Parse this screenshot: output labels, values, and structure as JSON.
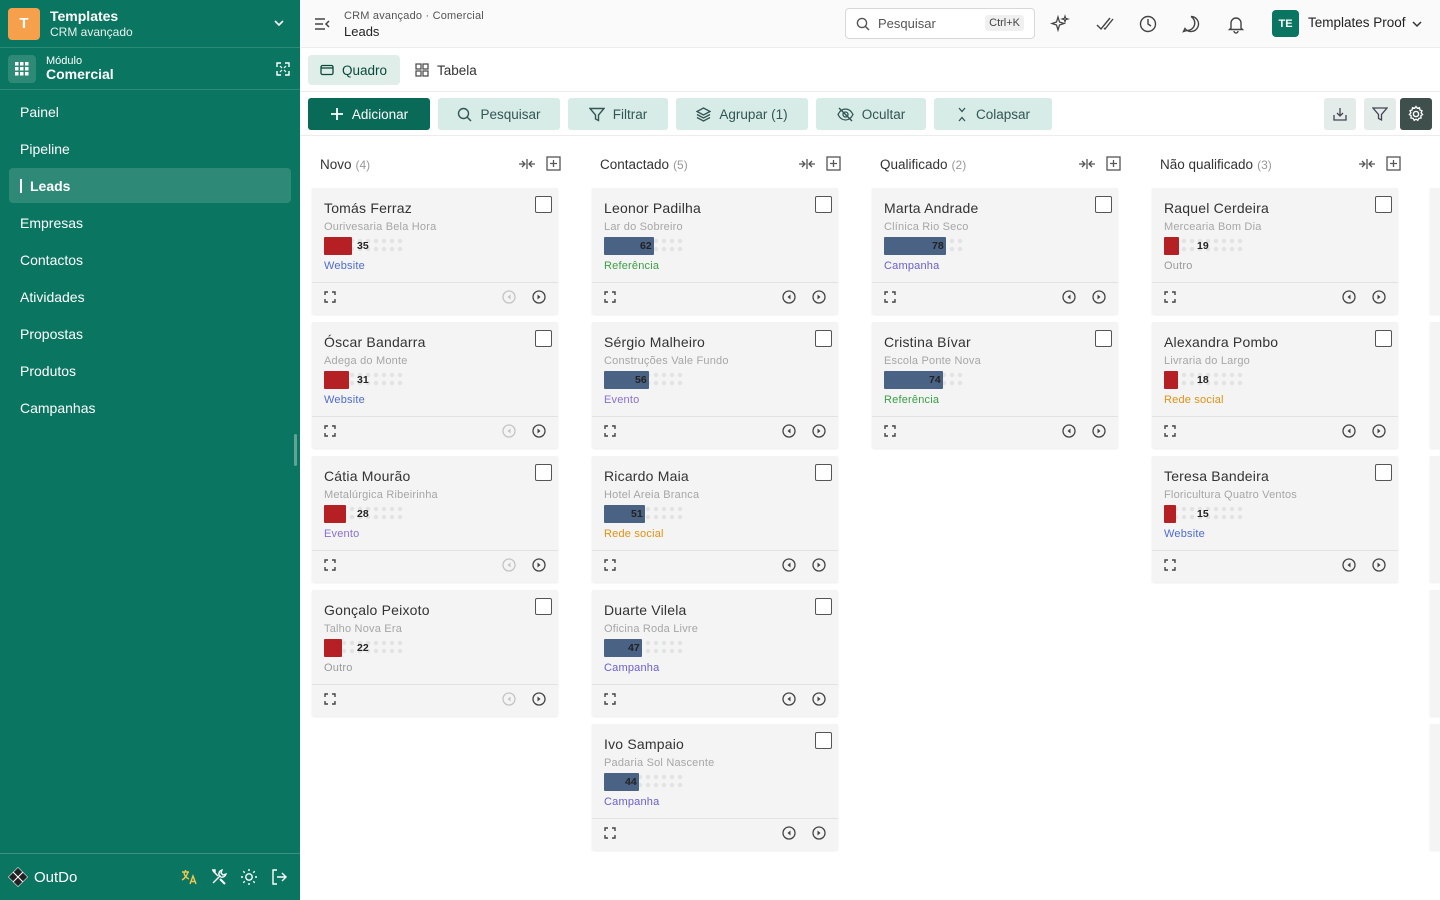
{
  "sidebar": {
    "workspace_initial": "T",
    "workspace_title": "Templates",
    "workspace_subtitle": "CRM avançado",
    "module_label": "Módulo",
    "module_name": "Comercial",
    "items": [
      {
        "label": "Painel"
      },
      {
        "label": "Pipeline"
      },
      {
        "label": "Leads",
        "active": true
      },
      {
        "label": "Empresas"
      },
      {
        "label": "Contactos"
      },
      {
        "label": "Atividades"
      },
      {
        "label": "Propostas"
      },
      {
        "label": "Produtos"
      },
      {
        "label": "Campanhas"
      }
    ],
    "brand": "OutDo"
  },
  "topbar": {
    "breadcrumb": "CRM avançado · Comercial",
    "title": "Leads",
    "search_placeholder": "Pesquisar",
    "search_shortcut": "Ctrl+K",
    "user_initials": "TE",
    "user_name": "Templates Proof"
  },
  "tabs": [
    {
      "label": "Quadro",
      "active": true
    },
    {
      "label": "Tabela"
    }
  ],
  "toolbar": {
    "add": "Adicionar",
    "search": "Pesquisar",
    "filter": "Filtrar",
    "group": "Agrupar (1)",
    "hide": "Ocultar",
    "collapse": "Colapsar"
  },
  "colors": {
    "sidebar_bg": "#0a7560",
    "accent": "#0a6a58",
    "score_low": "#b52025",
    "score_high": "#4a6283",
    "source_website": "#4f6bd4",
    "source_referencia": "#3aa046",
    "source_campanha": "#6a5fd0",
    "source_evento": "#8a6fd4",
    "source_rede_social": "#e29212",
    "source_outro": "#9a9a9a"
  },
  "board": {
    "columns": [
      {
        "name": "Novo",
        "count": "(4)",
        "cards": [
          {
            "name": "Tomás Ferraz",
            "company": "Ourivesaria Bela Hora",
            "score": 35,
            "source": "Website",
            "source_color": "#4f6bd4"
          },
          {
            "name": "Óscar Bandarra",
            "company": "Adega do Monte",
            "score": 31,
            "source": "Website",
            "source_color": "#4f6bd4"
          },
          {
            "name": "Cátia Mourão",
            "company": "Metalúrgica Ribeirinha",
            "score": 28,
            "source": "Evento",
            "source_color": "#8a6fd4"
          },
          {
            "name": "Gonçalo Peixoto",
            "company": "Talho Nova Era",
            "score": 22,
            "source": "Outro",
            "source_color": "#9a9a9a"
          }
        ]
      },
      {
        "name": "Contactado",
        "count": "(5)",
        "cards": [
          {
            "name": "Leonor Padilha",
            "company": "Lar do Sobreiro",
            "score": 62,
            "source": "Referência",
            "source_color": "#3aa046"
          },
          {
            "name": "Sérgio Malheiro",
            "company": "Construções Vale Fundo",
            "score": 56,
            "source": "Evento",
            "source_color": "#8a6fd4"
          },
          {
            "name": "Ricardo Maia",
            "company": "Hotel Areia Branca",
            "score": 51,
            "source": "Rede social",
            "source_color": "#e29212"
          },
          {
            "name": "Duarte Vilela",
            "company": "Oficina Roda Livre",
            "score": 47,
            "source": "Campanha",
            "source_color": "#6a5fd0"
          },
          {
            "name": "Ivo Sampaio",
            "company": "Padaria Sol Nascente",
            "score": 44,
            "source": "Campanha",
            "source_color": "#6a5fd0"
          }
        ]
      },
      {
        "name": "Qualificado",
        "count": "(2)",
        "cards": [
          {
            "name": "Marta Andrade",
            "company": "Clínica Rio Seco",
            "score": 78,
            "source": "Campanha",
            "source_color": "#6a5fd0"
          },
          {
            "name": "Cristina Bívar",
            "company": "Escola Ponte Nova",
            "score": 74,
            "source": "Referência",
            "source_color": "#3aa046"
          }
        ]
      },
      {
        "name": "Não qualificado",
        "count": "(3)",
        "cards": [
          {
            "name": "Raquel Cerdeira",
            "company": "Mercearia Bom Dia",
            "score": 19,
            "source": "Outro",
            "source_color": "#9a9a9a"
          },
          {
            "name": "Alexandra Pombo",
            "company": "Livraria do Largo",
            "score": 18,
            "source": "Rede social",
            "source_color": "#e29212"
          },
          {
            "name": "Teresa Bandeira",
            "company": "Floricultura Quatro Ventos",
            "score": 15,
            "source": "Website",
            "source_color": "#4f6bd4"
          }
        ]
      }
    ]
  }
}
